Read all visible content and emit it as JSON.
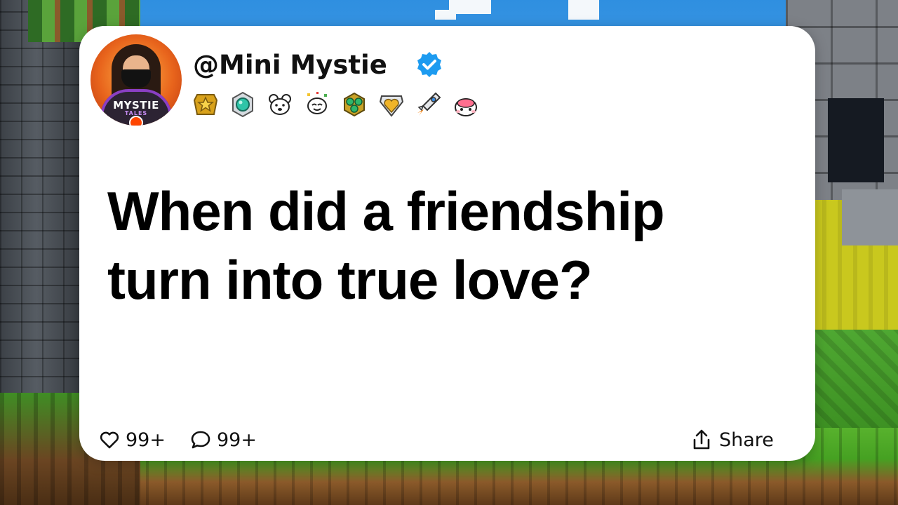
{
  "post": {
    "username": "@Mini Mystie",
    "avatar_text": "MYSTIE",
    "avatar_subtext": "TALES",
    "verified": true,
    "awards": [
      "gold-star-award-icon",
      "gem-award-icon",
      "bear-award-icon",
      "confetti-award-icon",
      "leaf-award-icon",
      "heart-award-icon",
      "rocket-award-icon",
      "cake-award-icon"
    ],
    "question_line1": "When did a friendship",
    "question_line2": "turn into true love?",
    "likes": "99+",
    "comments": "99+",
    "share_label": "Share"
  },
  "colors": {
    "card": "#ffffff",
    "verified_badge": "#1d9bf0",
    "text": "#000000",
    "avatar_ring": "#e8641c"
  }
}
